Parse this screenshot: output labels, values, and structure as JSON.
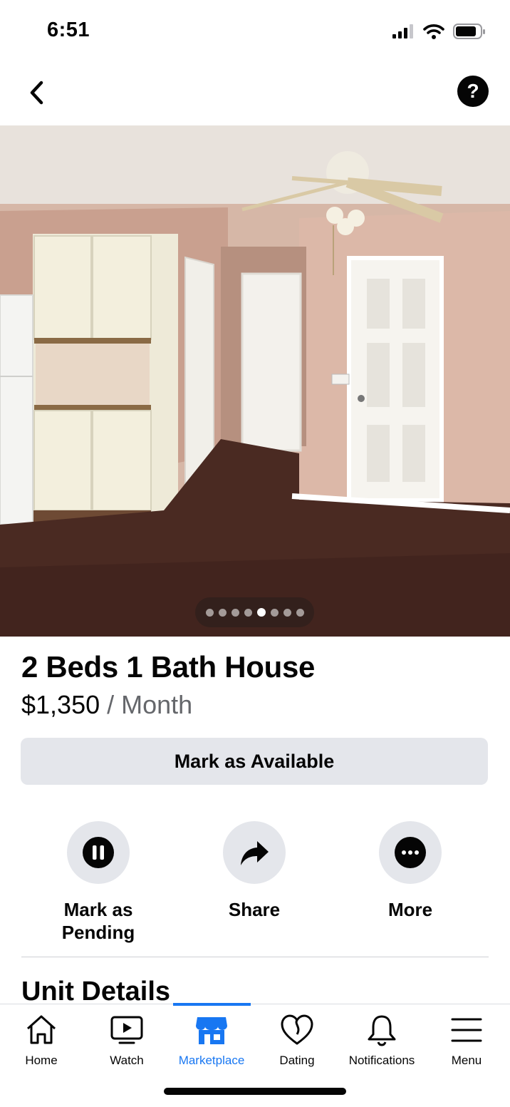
{
  "status_bar": {
    "time": "6:51",
    "signal_icon": "cellular-signal-icon",
    "wifi_icon": "wifi-icon",
    "battery_icon": "battery-icon"
  },
  "nav": {
    "back_icon": "chevron-left-icon",
    "help_label": "?"
  },
  "photo": {
    "description_icon": "listing-photo",
    "page_count": 8,
    "active_page": 5
  },
  "listing": {
    "title": "2 Beds 1 Bath House",
    "price": "$1,350",
    "price_unit": " / Month"
  },
  "primary_button": {
    "label": "Mark as Available"
  },
  "actions": [
    {
      "label_line1": "Mark as",
      "label_line2": "Pending",
      "icon": "pause-icon"
    },
    {
      "label_line1": "Share",
      "icon": "share-arrow-icon"
    },
    {
      "label_line1": "More",
      "icon": "more-dots-icon"
    }
  ],
  "section": {
    "title": "Unit Details"
  },
  "tabbar": {
    "active_color": "#1877f2",
    "tabs": [
      {
        "label": "Home",
        "icon": "home-icon"
      },
      {
        "label": "Watch",
        "icon": "watch-video-icon"
      },
      {
        "label": "Marketplace",
        "icon": "marketplace-shop-icon",
        "active": true
      },
      {
        "label": "Dating",
        "icon": "dating-heart-icon"
      },
      {
        "label": "Notifications",
        "icon": "bell-icon"
      },
      {
        "label": "Menu",
        "icon": "hamburger-menu-icon"
      }
    ]
  }
}
